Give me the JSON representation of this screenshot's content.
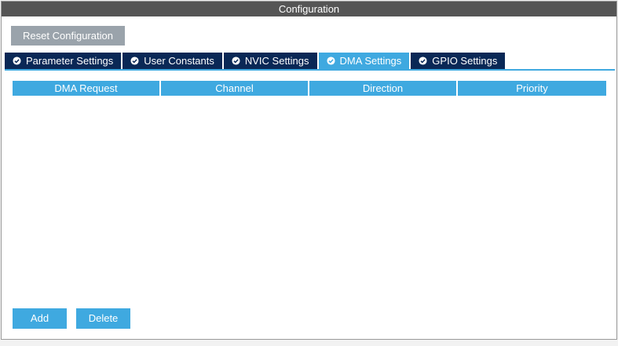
{
  "window": {
    "title": "Configuration"
  },
  "toolbar": {
    "reset_label": "Reset Configuration"
  },
  "tabs": [
    {
      "label": "Parameter Settings",
      "icon": "check-circle-icon",
      "active": false
    },
    {
      "label": "User Constants",
      "icon": "check-circle-icon",
      "active": false
    },
    {
      "label": "NVIC Settings",
      "icon": "check-circle-icon",
      "active": false
    },
    {
      "label": "DMA Settings",
      "icon": "check-circle-icon",
      "active": true
    },
    {
      "label": "GPIO Settings",
      "icon": "check-circle-icon",
      "active": false
    }
  ],
  "table": {
    "columns": [
      "DMA Request",
      "Channel",
      "Direction",
      "Priority"
    ],
    "rows": []
  },
  "actions": {
    "add_label": "Add",
    "delete_label": "Delete"
  },
  "colors": {
    "accent": "#3fa9e0",
    "tab_dark": "#0a2856",
    "title_bg": "#555555",
    "reset_bg": "#9aa3ab"
  }
}
